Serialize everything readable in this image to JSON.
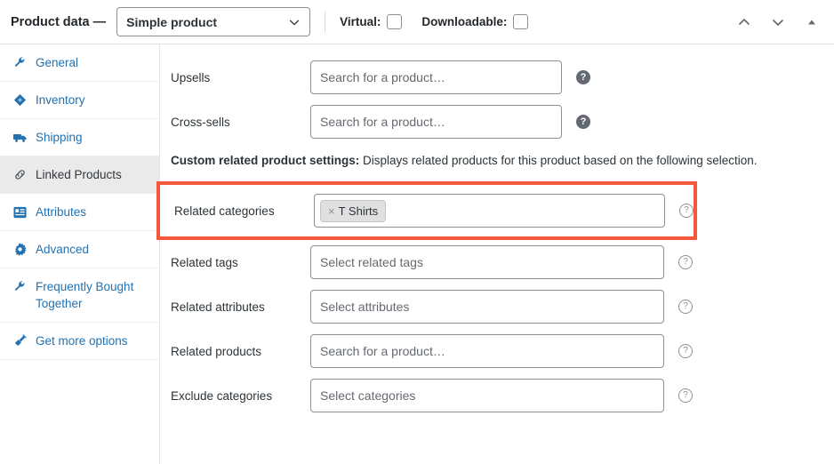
{
  "header": {
    "title": "Product data —",
    "product_type": "Simple product",
    "caret_icon": "chevron-down-icon",
    "virtual_label": "Virtual:",
    "downloadable_label": "Downloadable:",
    "virtual_checked": false,
    "downloadable_checked": false,
    "actions": [
      {
        "icon": "chevron-up-icon"
      },
      {
        "icon": "chevron-down-icon"
      },
      {
        "icon": "triangle-up-icon"
      }
    ]
  },
  "sidebar": {
    "items": [
      {
        "label": "General",
        "icon": "wrench-icon",
        "active": false
      },
      {
        "label": "Inventory",
        "icon": "archive-icon",
        "active": false
      },
      {
        "label": "Shipping",
        "icon": "truck-icon",
        "active": false
      },
      {
        "label": "Linked Products",
        "icon": "link-icon",
        "active": true
      },
      {
        "label": "Attributes",
        "icon": "list-icon",
        "active": false
      },
      {
        "label": "Advanced",
        "icon": "gear-icon",
        "active": false
      },
      {
        "label": "Frequently Bought Together",
        "icon": "wrench-icon",
        "active": false
      },
      {
        "label": "Get more options",
        "icon": "plugin-icon",
        "active": false
      }
    ]
  },
  "main": {
    "upsells": {
      "label": "Upsells",
      "placeholder": "Search for a product…",
      "value": "",
      "help_icon": "help-filled-icon"
    },
    "cross_sells": {
      "label": "Cross-sells",
      "placeholder": "Search for a product…",
      "value": "",
      "help_icon": "help-filled-icon"
    },
    "notice": {
      "strong": "Custom related product settings:",
      "text": " Displays related products for this product based on the following selection."
    },
    "related_categories": {
      "label": "Related categories",
      "tags": [
        {
          "label": "T Shirts",
          "remove_icon": "close-icon"
        }
      ],
      "help_icon": "help-outline-icon",
      "highlight_color": "#f4573c"
    },
    "related_tags": {
      "label": "Related tags",
      "placeholder": "Select related tags",
      "value": "",
      "help_icon": "help-outline-icon"
    },
    "related_attributes": {
      "label": "Related attributes",
      "placeholder": "Select attributes",
      "value": "",
      "help_icon": "help-outline-icon"
    },
    "related_products": {
      "label": "Related products",
      "placeholder": "Search for a product…",
      "value": "",
      "help_icon": "help-outline-icon"
    },
    "exclude_categories": {
      "label": "Exclude categories",
      "placeholder": "Select categories",
      "value": "",
      "help_icon": "help-outline-icon"
    }
  },
  "colors": {
    "link": "#2271b1",
    "accent_highlight": "#f4573c",
    "active_tab_bg": "#eaeaea"
  }
}
